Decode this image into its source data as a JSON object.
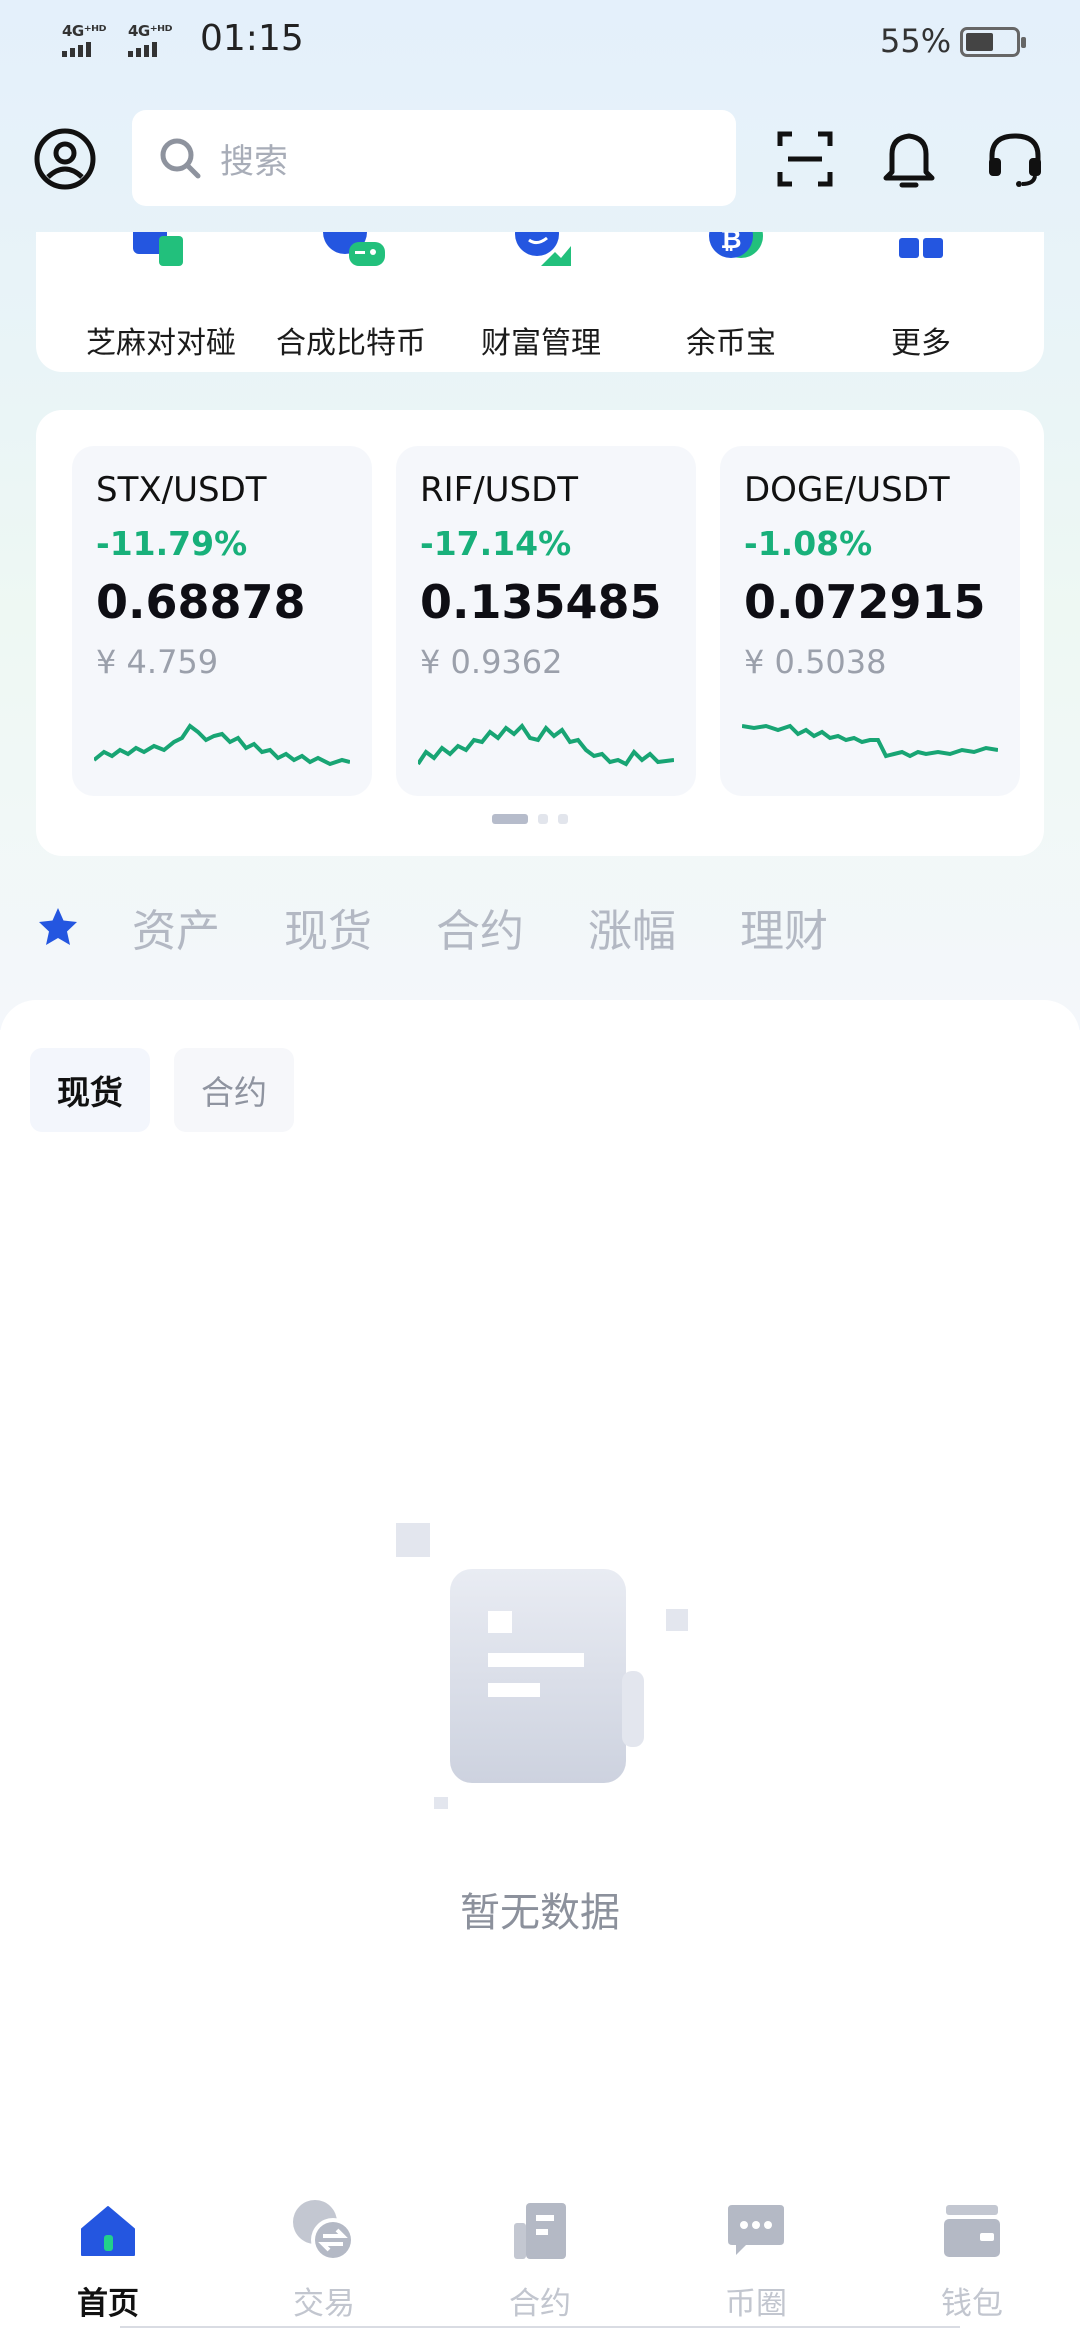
{
  "status_bar": {
    "signal_1": "4G⁺ᴴᴰ",
    "signal_2": "4G⁺ᴴᴰ",
    "time": "01:15",
    "battery_percent": "55%",
    "battery_level": 0.55
  },
  "header": {
    "search_placeholder": "搜索"
  },
  "shortcuts": [
    {
      "label": "芝麻对对碰",
      "icon": "puzzle-icon"
    },
    {
      "label": "合成比特币",
      "icon": "gamepad-icon"
    },
    {
      "label": "财富管理",
      "icon": "wealth-icon"
    },
    {
      "label": "余币宝",
      "icon": "bitcoin-icon"
    },
    {
      "label": "更多",
      "icon": "grid-icon"
    }
  ],
  "tickers": [
    {
      "pair": "STX/USDT",
      "change": "-11.79%",
      "price": "0.68878",
      "cny": "¥ 4.759"
    },
    {
      "pair": "RIF/USDT",
      "change": "-17.14%",
      "price": "0.135485",
      "cny": "¥ 0.9362"
    },
    {
      "pair": "DOGE/USDT",
      "change": "-1.08%",
      "price": "0.072915",
      "cny": "¥ 0.5038"
    }
  ],
  "tabs": [
    "资产",
    "现货",
    "合约",
    "涨幅",
    "理财"
  ],
  "sub_tabs": {
    "spot": "现货",
    "contract": "合约"
  },
  "empty_state": "暂无数据",
  "bottom_nav": [
    {
      "label": "首页",
      "icon": "home-icon",
      "active": true
    },
    {
      "label": "交易",
      "icon": "exchange-icon",
      "active": false
    },
    {
      "label": "合约",
      "icon": "contract-icon",
      "active": false
    },
    {
      "label": "币圈",
      "icon": "chat-icon",
      "active": false
    },
    {
      "label": "钱包",
      "icon": "wallet-icon",
      "active": false
    }
  ],
  "colors": {
    "accent": "#2456e0",
    "up_down_green": "#18b07a",
    "muted": "#b3b8c3"
  }
}
